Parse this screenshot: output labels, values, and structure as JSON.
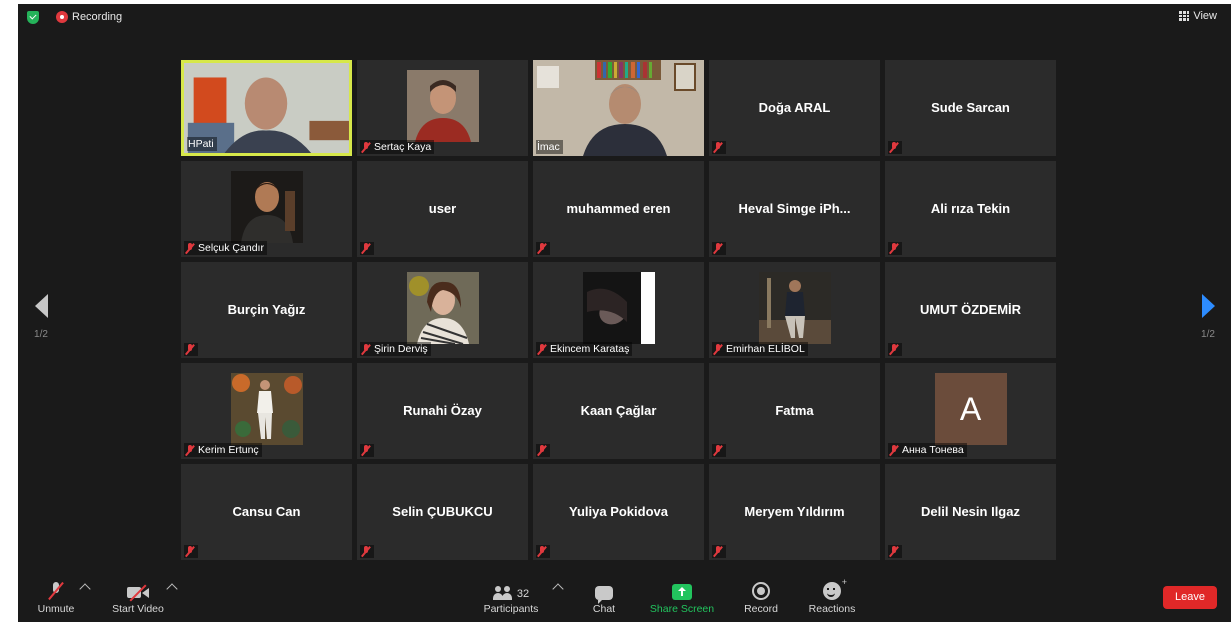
{
  "topbar": {
    "recording_label": "Recording",
    "view_label": "View"
  },
  "colors": {
    "accent": "#2d8cff",
    "active_speaker_border": "#d7e84a",
    "share_green": "#22c45e",
    "leave_red": "#e02828",
    "muted_red": "#e0393e",
    "tile_bg": "#2b2b2b"
  },
  "pagination": {
    "left_page": "1/2",
    "right_page": "1/2"
  },
  "tiles": [
    {
      "name": "HPati",
      "mode": "video"
    },
    {
      "name": "Sertaç Kaya",
      "mode": "photo"
    },
    {
      "name": "İmac",
      "mode": "video"
    },
    {
      "name": "Doğa ARAL",
      "mode": "name"
    },
    {
      "name": "Sude Sarcan",
      "mode": "name"
    },
    {
      "name": "Selçuk Çandır",
      "mode": "photo"
    },
    {
      "name": "user",
      "mode": "name"
    },
    {
      "name": "muhammed  eren",
      "mode": "name"
    },
    {
      "name": "Heval Simge  iPh...",
      "mode": "name"
    },
    {
      "name": "Ali rıza Tekin",
      "mode": "name"
    },
    {
      "name": "Burçin Yağız",
      "mode": "name"
    },
    {
      "name": "Şirin Derviş",
      "mode": "photo"
    },
    {
      "name": "Ekincem Karataş",
      "mode": "photo"
    },
    {
      "name": "Emirhan ELİBOL",
      "mode": "photo"
    },
    {
      "name": "UMUT ÖZDEMİR",
      "mode": "name"
    },
    {
      "name": "Kerim Ertunç",
      "mode": "photo"
    },
    {
      "name": "Runahi Özay",
      "mode": "name"
    },
    {
      "name": "Kaan Çağlar",
      "mode": "name"
    },
    {
      "name": "Fatma",
      "mode": "name"
    },
    {
      "name": "Анна Тонева",
      "mode": "avatar",
      "avatar_letter": "A"
    },
    {
      "name": "Cansu Can",
      "mode": "name"
    },
    {
      "name": "Selin ÇUBUKCU",
      "mode": "name"
    },
    {
      "name": "Yuliya Pokidova",
      "mode": "name"
    },
    {
      "name": "Meryem Yıldırım",
      "mode": "name"
    },
    {
      "name": "Delil Nesin Ilgaz",
      "mode": "name"
    }
  ],
  "toolbar": {
    "unmute_label": "Unmute",
    "start_video_label": "Start Video",
    "participants_label": "Participants",
    "participants_count": "32",
    "chat_label": "Chat",
    "share_label": "Share Screen",
    "record_label": "Record",
    "reactions_label": "Reactions",
    "leave_label": "Leave"
  }
}
